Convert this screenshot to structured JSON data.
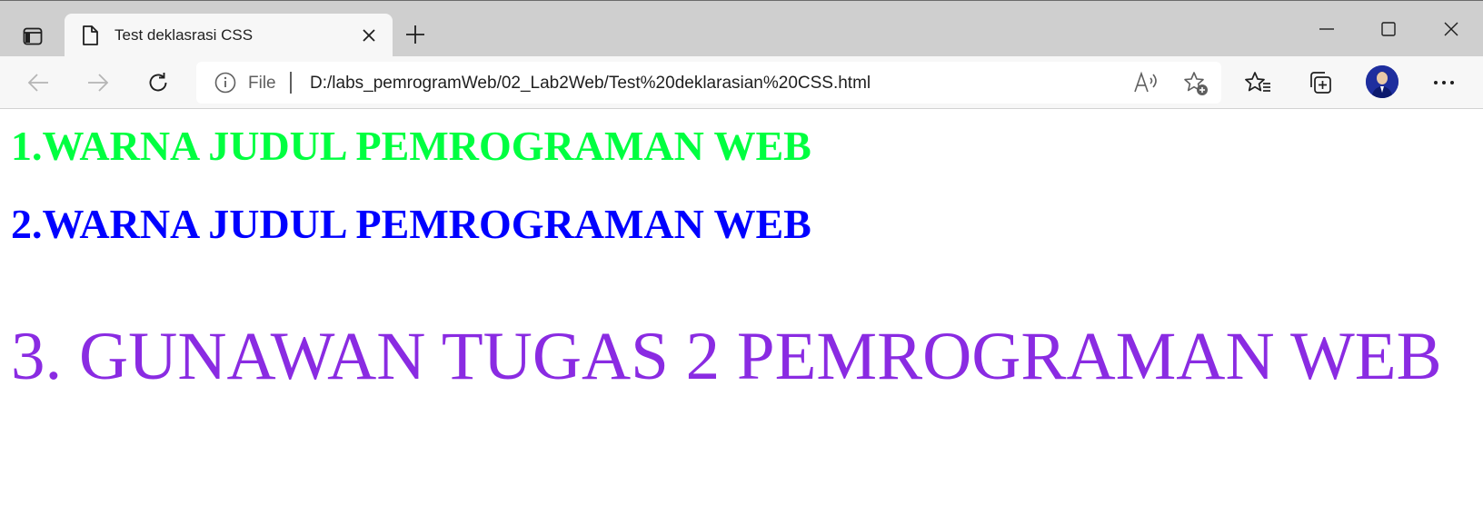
{
  "browser": {
    "tab": {
      "title": "Test deklasrasi CSS"
    },
    "address": {
      "scheme_label": "File",
      "url": "D:/labs_pemrogramWeb/02_Lab2Web/Test%20deklarasian%20CSS.html"
    },
    "icons": {
      "tab_actions": "tab-actions-icon",
      "favicon": "page-icon",
      "tab_close": "close-icon",
      "new_tab": "plus-icon",
      "minimize": "minimize-icon",
      "maximize": "maximize-icon",
      "close_window": "close-icon",
      "back": "back-arrow-icon",
      "forward": "forward-arrow-icon",
      "refresh": "refresh-icon",
      "site_info": "info-icon",
      "read_aloud": "read-aloud-icon",
      "add_favorite": "add-favorite-icon",
      "favorites": "favorites-icon",
      "collections": "collections-icon",
      "profile": "profile-avatar",
      "more": "more-icon"
    }
  },
  "page": {
    "heading1": "1.WARNA JUDUL PEMROGRAMAN WEB",
    "heading2": "2.WARNA JUDUL PEMROGRAMAN WEB",
    "heading3": "3. GUNAWAN TUGAS 2 PEMROGRAMAN WEB"
  },
  "colors": {
    "heading1": "#00ff40",
    "heading2": "#0000ff",
    "heading3": "#8a2be2",
    "tabstrip": "#cfcfcf",
    "toolbar": "#f7f7f7"
  }
}
